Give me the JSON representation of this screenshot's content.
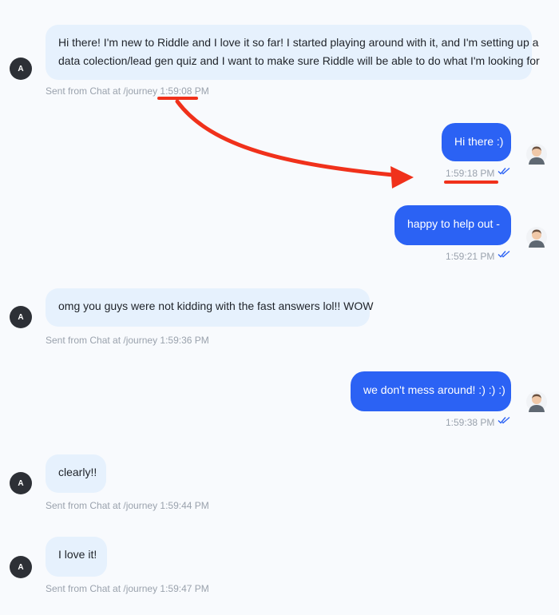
{
  "accent_color": "#2b62f4",
  "annotation_color": "#f0311b",
  "conversation": {
    "visitor_initial": "A",
    "messages": [
      {
        "direction": "incoming",
        "lines": [
          "Hi there! I'm new to Riddle and I love it so far! I started playing around with it, and I'm setting up a",
          "data colection/lead gen quiz and I want to make sure Riddle will be able to do what I'm looking for"
        ],
        "meta_prefix": "Sent from Chat at /journey ",
        "time": "1:59:08 PM"
      },
      {
        "direction": "outgoing",
        "text": "Hi there :)",
        "time": "1:59:18 PM",
        "read_icon": "double-check-icon"
      },
      {
        "direction": "outgoing",
        "text": "happy to help out -",
        "time": "1:59:21 PM",
        "read_icon": "double-check-icon"
      },
      {
        "direction": "incoming",
        "text": "omg you guys were not kidding with the fast answers lol!! WOW",
        "meta": "Sent from Chat at /journey 1:59:36 PM"
      },
      {
        "direction": "outgoing",
        "text": "we don't mess around! :) :) :)",
        "time": "1:59:38 PM",
        "read_icon": "double-check-icon"
      },
      {
        "direction": "incoming",
        "text": "clearly!!",
        "meta": "Sent from Chat at /journey 1:59:44 PM"
      },
      {
        "direction": "incoming",
        "text": "I love it!",
        "meta": "Sent from Chat at /journey 1:59:47 PM"
      }
    ]
  }
}
